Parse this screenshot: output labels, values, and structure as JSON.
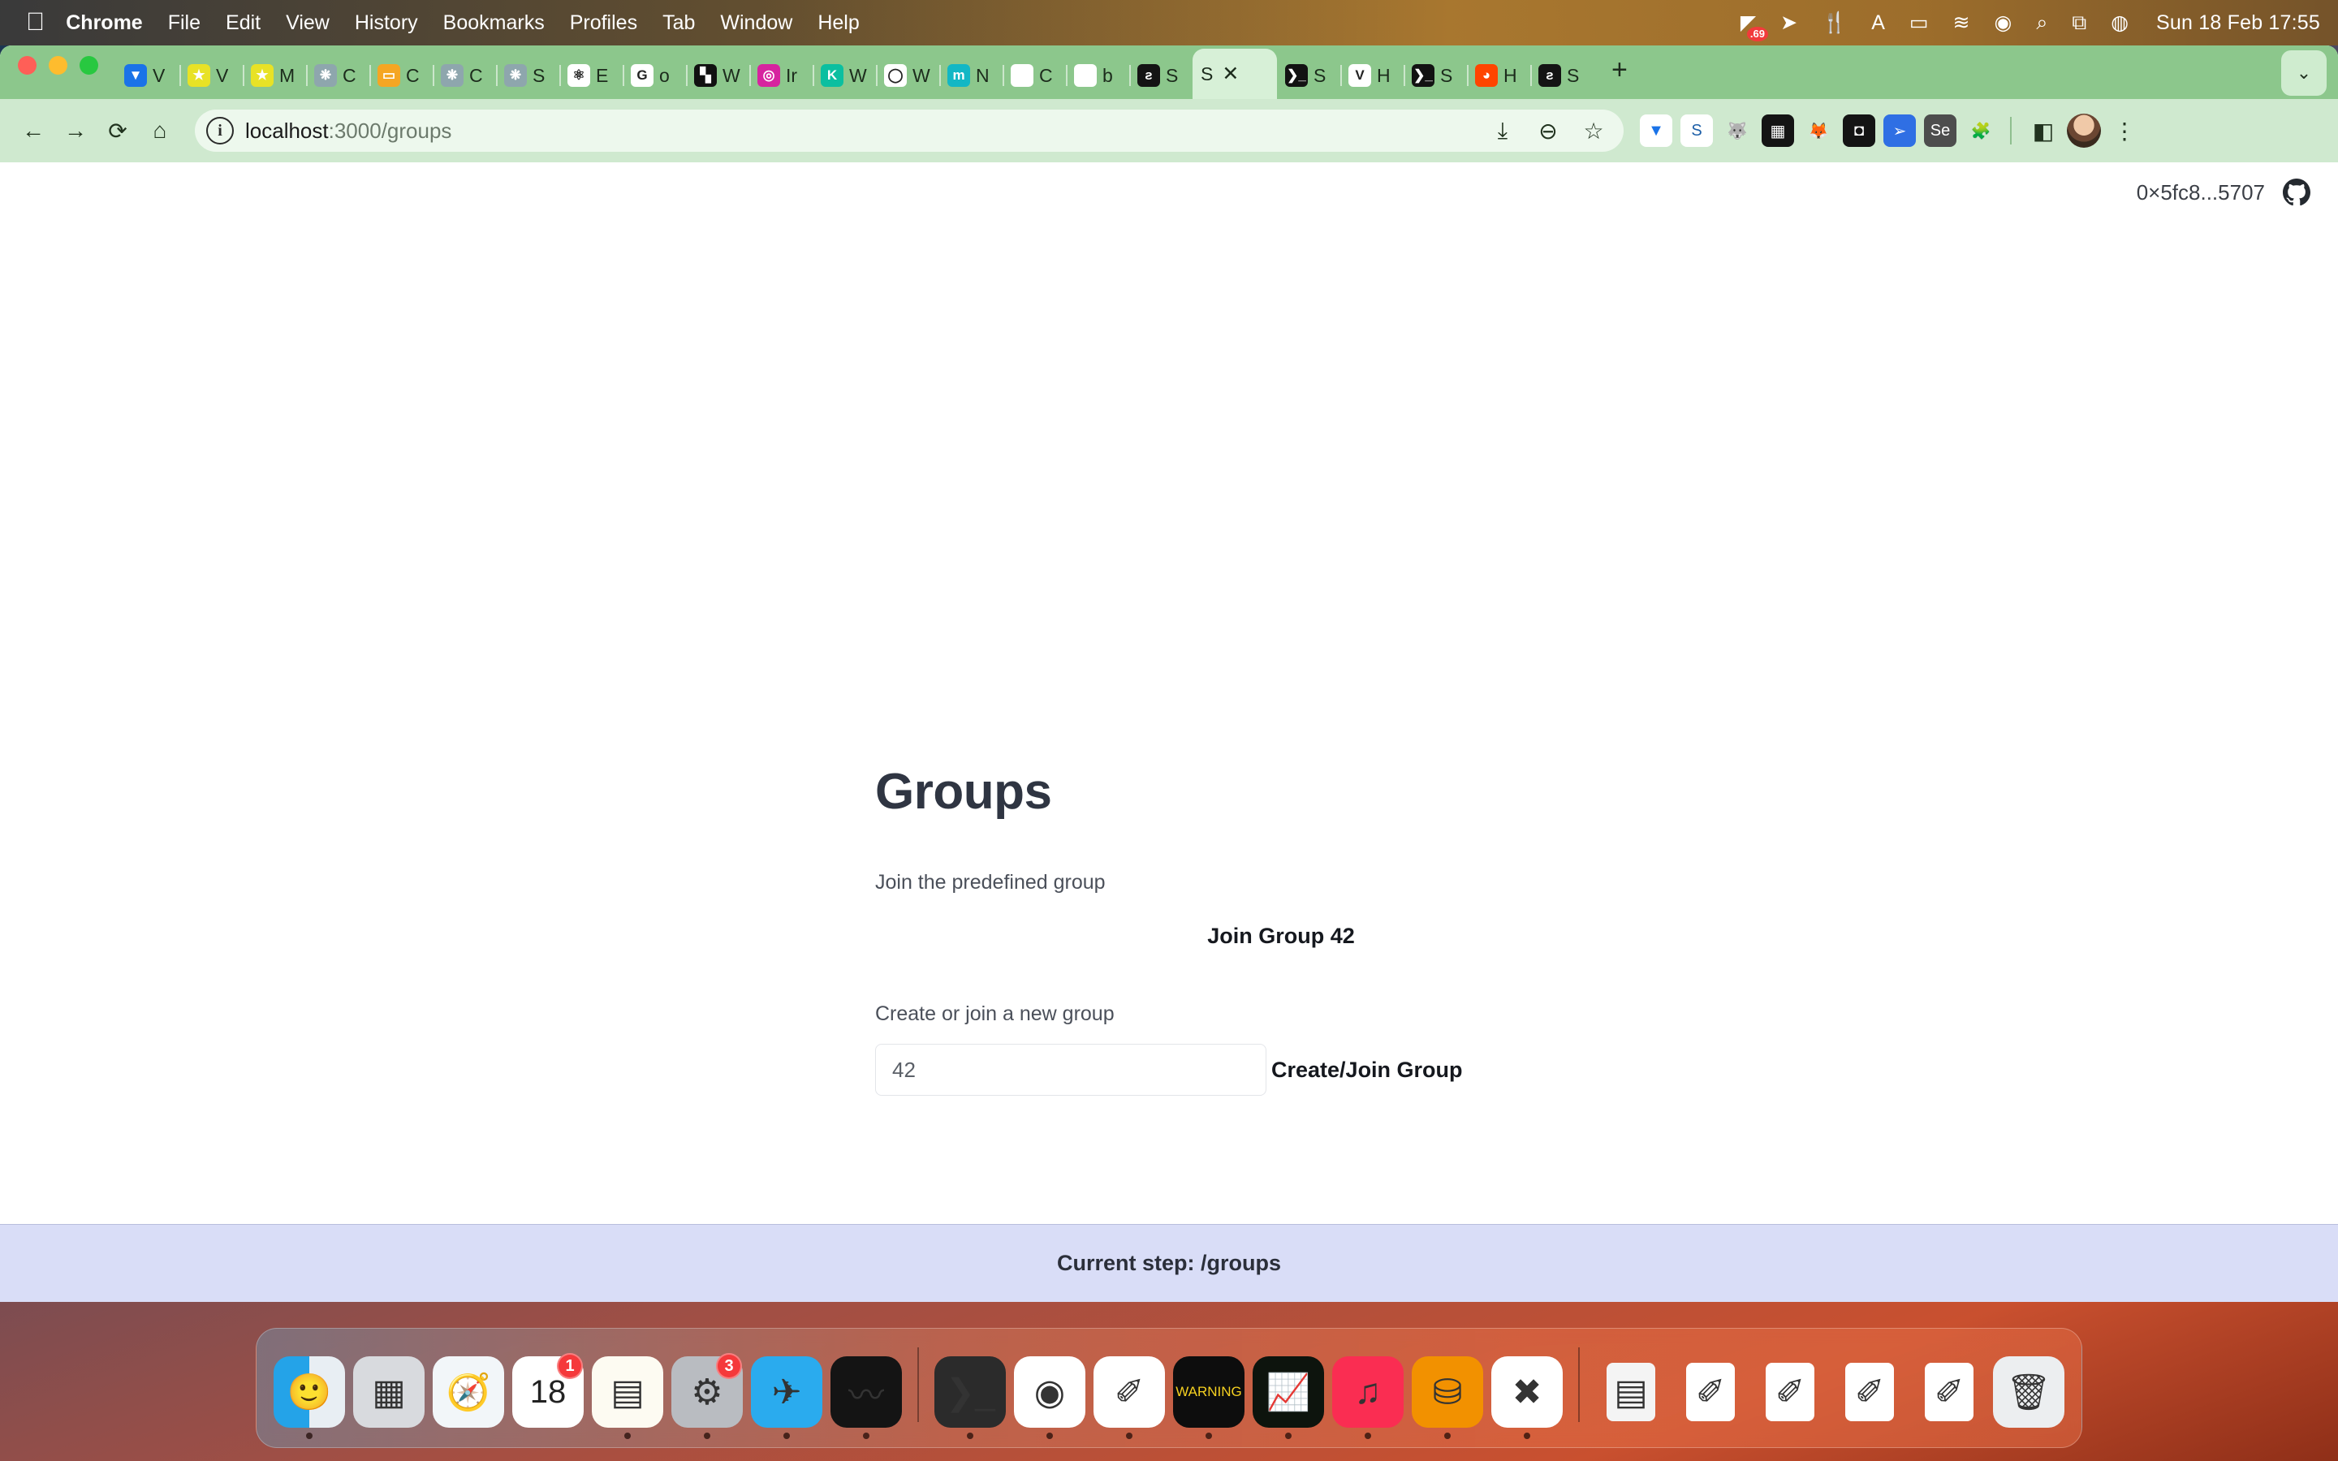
{
  "menubar": {
    "apple_icon": "apple-icon",
    "items": [
      {
        "label": "Chrome",
        "bold": true
      },
      {
        "label": "File",
        "bold": false
      },
      {
        "label": "Edit",
        "bold": false
      },
      {
        "label": "View",
        "bold": false
      },
      {
        "label": "History",
        "bold": false
      },
      {
        "label": "Bookmarks",
        "bold": false
      },
      {
        "label": "Profiles",
        "bold": false
      },
      {
        "label": "Tab",
        "bold": false
      },
      {
        "label": "Window",
        "bold": false
      },
      {
        "label": "Help",
        "bold": false
      }
    ],
    "status_icons": [
      {
        "name": "stats-icon",
        "glyph": "◤",
        "badge": ".69"
      },
      {
        "name": "location-off-icon",
        "glyph": "➤",
        "badge": ""
      },
      {
        "name": "utensils-icon",
        "glyph": "🍴",
        "badge": ""
      },
      {
        "name": "input-source-icon",
        "glyph": "A",
        "badge": ""
      },
      {
        "name": "battery-icon",
        "glyph": "▭",
        "badge": ""
      },
      {
        "name": "wifi-icon",
        "glyph": "≋",
        "badge": ""
      },
      {
        "name": "user-account-icon",
        "glyph": "◉",
        "badge": ""
      },
      {
        "name": "search-icon",
        "glyph": "⌕",
        "badge": ""
      },
      {
        "name": "control-center-icon",
        "glyph": "⧉",
        "badge": ""
      },
      {
        "name": "siri-icon",
        "glyph": "◍",
        "badge": ""
      }
    ],
    "clock": "Sun 18 Feb  17:55"
  },
  "browser": {
    "tabs": [
      {
        "label": "V",
        "favicon": "vite-icon",
        "fav_bg": "#1a73e8",
        "fav_text": "▼",
        "active": false
      },
      {
        "label": "V",
        "favicon": "star-yellow-icon",
        "fav_bg": "#e8e226",
        "fav_text": "★",
        "active": false
      },
      {
        "label": "M",
        "favicon": "star-yellow-icon",
        "fav_bg": "#e8e226",
        "fav_text": "★",
        "active": false
      },
      {
        "label": "C",
        "favicon": "openai-icon",
        "fav_bg": "#8ea6ad",
        "fav_text": "❋",
        "active": false
      },
      {
        "label": "C",
        "favicon": "orange-window-icon",
        "fav_bg": "#f5a623",
        "fav_text": "▭",
        "active": false
      },
      {
        "label": "C",
        "favicon": "openai-icon",
        "fav_bg": "#8ea6ad",
        "fav_text": "❋",
        "active": false
      },
      {
        "label": "S",
        "favicon": "openai-icon",
        "fav_bg": "#8ea6ad",
        "fav_text": "❋",
        "active": false
      },
      {
        "label": "E",
        "favicon": "atom-icon",
        "fav_bg": "#ffffff",
        "fav_text": "⚛",
        "active": false
      },
      {
        "label": "o",
        "favicon": "google-icon",
        "fav_bg": "#ffffff",
        "fav_text": "G",
        "active": false
      },
      {
        "label": "W",
        "favicon": "qr-black-icon",
        "fav_bg": "#111111",
        "fav_text": "▚",
        "active": false
      },
      {
        "label": "Ir",
        "favicon": "instagram-icon",
        "fav_bg": "#d6249f",
        "fav_text": "◎",
        "active": false
      },
      {
        "label": "W",
        "favicon": "kaggle-icon",
        "fav_bg": "#0bbfa0",
        "fav_text": "K",
        "active": false
      },
      {
        "label": "W",
        "favicon": "ellipse-black-icon",
        "fav_bg": "#ffffff",
        "fav_text": "◯",
        "active": false
      },
      {
        "label": "N",
        "favicon": "medium-icon",
        "fav_bg": "#12b7c5",
        "fav_text": "m",
        "active": false
      },
      {
        "label": "C",
        "favicon": "github-icon",
        "fav_bg": "#ffffff",
        "fav_text": "",
        "active": false
      },
      {
        "label": "b",
        "favicon": "github-icon",
        "fav_bg": "#ffffff",
        "fav_text": "",
        "active": false
      },
      {
        "label": "S",
        "favicon": "scroll-black-icon",
        "fav_bg": "#141414",
        "fav_text": "ƨ",
        "active": false
      },
      {
        "label": "S",
        "favicon": "page-icon",
        "fav_bg": "#d7f0d7",
        "fav_text": "",
        "active": true
      },
      {
        "label": "S",
        "favicon": "terminal-icon",
        "fav_bg": "#121212",
        "fav_text": "❯_",
        "active": false
      },
      {
        "label": "H",
        "favicon": "vue-icon",
        "fav_bg": "#ffffff",
        "fav_text": "V",
        "active": false
      },
      {
        "label": "S",
        "favicon": "terminal-icon",
        "fav_bg": "#121212",
        "fav_text": "❯_",
        "active": false
      },
      {
        "label": "H",
        "favicon": "reddit-icon",
        "fav_bg": "#ff4500",
        "fav_text": "◕",
        "active": false
      },
      {
        "label": "S",
        "favicon": "scroll-black-icon",
        "fav_bg": "#141414",
        "fav_text": "ƨ",
        "active": false
      }
    ],
    "close_tab_glyph": "✕",
    "new_tab_glyph": "+",
    "tab_list_glyph": "⌄",
    "nav": {
      "back": "←",
      "forward": "→",
      "reload": "⟳",
      "home": "⌂"
    },
    "omnibox": {
      "info_glyph": "i",
      "url_host": "localhost",
      "url_rest": ":3000/groups",
      "actions": [
        {
          "name": "install-app-icon",
          "glyph": "⤓"
        },
        {
          "name": "zoom-out-icon",
          "glyph": "⊖"
        },
        {
          "name": "bookmark-star-icon",
          "glyph": "☆"
        }
      ]
    },
    "extensions": [
      {
        "name": "vite-extension-icon",
        "glyph": "▼",
        "bg": "#ffffff",
        "color": "#1a73e8"
      },
      {
        "name": "scribe-extension-icon",
        "glyph": "S",
        "bg": "#ffffff",
        "color": "#1d5fa8"
      },
      {
        "name": "wolf-extension-icon",
        "glyph": "🐺",
        "bg": "#cfe9cf",
        "color": "#8a8a8a"
      },
      {
        "name": "dark-grid-extension-icon",
        "glyph": "▦",
        "bg": "#141414",
        "color": "#ffffff"
      },
      {
        "name": "metamask-extension-icon",
        "glyph": "🦊",
        "bg": "#cfe9cf",
        "color": "#e2761b"
      },
      {
        "name": "keyhole-extension-icon",
        "glyph": "◘",
        "bg": "#141414",
        "color": "#ffffff"
      },
      {
        "name": "blue-arrow-extension-icon",
        "glyph": "➢",
        "bg": "#2f6fe4",
        "color": "#ffffff"
      },
      {
        "name": "selenium-extension-icon",
        "glyph": "Se",
        "bg": "#4d4d4d",
        "color": "#ffffff"
      },
      {
        "name": "puzzle-extensions-icon",
        "glyph": "🧩",
        "bg": "#cfe9cf",
        "color": "#2b2b2b"
      }
    ],
    "side_panel_glyph": "◧",
    "menu_glyph": "⋮",
    "profile_name": "avatar"
  },
  "wallet": {
    "address": "0×5fc8...5707",
    "github_icon": "github-icon"
  },
  "main": {
    "title": "Groups",
    "predefined_label": "Join the predefined group",
    "join_button": "Join Group 42",
    "create_label": "Create or join a new group",
    "group_input_value": "42",
    "group_input_placeholder": "42",
    "create_button": "Create/Join Group"
  },
  "footer": {
    "status": "Current step: /groups"
  },
  "dock": {
    "items": [
      {
        "name": "finder",
        "glyph": "🙂",
        "bg": "linear-gradient(90deg,#24a3e8 0 50%,#e8eef3 50% 100%)",
        "badge": "",
        "running": true,
        "small": false
      },
      {
        "name": "launchpad",
        "glyph": "▦",
        "bg": "#d8dade",
        "badge": "",
        "running": false,
        "small": false
      },
      {
        "name": "safari",
        "glyph": "🧭",
        "bg": "#f2f6f9",
        "badge": "",
        "running": false,
        "small": false
      },
      {
        "name": "calendar",
        "glyph": "18",
        "bg": "#ffffff",
        "badge": "1",
        "running": false,
        "small": false
      },
      {
        "name": "notes",
        "glyph": "▤",
        "bg": "#fdfbf2",
        "badge": "",
        "running": true,
        "small": false
      },
      {
        "name": "system-preferences",
        "glyph": "⚙",
        "bg": "#b9bcc1",
        "badge": "3",
        "running": true,
        "small": false
      },
      {
        "name": "telegram",
        "glyph": "✈",
        "bg": "#2aabee",
        "badge": "",
        "running": true,
        "small": false
      },
      {
        "name": "voice-memos",
        "glyph": "〰",
        "bg": "#141414",
        "badge": "",
        "running": true,
        "small": false
      },
      {
        "name": "separator",
        "glyph": "",
        "bg": "",
        "badge": "",
        "running": false,
        "small": false
      },
      {
        "name": "terminal",
        "glyph": "❯_",
        "bg": "#2b2b2b",
        "badge": "",
        "running": true,
        "small": false
      },
      {
        "name": "google-chrome",
        "glyph": "◉",
        "bg": "#ffffff",
        "badge": "",
        "running": true,
        "small": false
      },
      {
        "name": "textedit",
        "glyph": "✐",
        "bg": "#ffffff",
        "badge": "",
        "running": true,
        "small": false
      },
      {
        "name": "watch-warning",
        "glyph": "WARNING",
        "bg": "#0d0d0d",
        "badge": "",
        "running": true,
        "small": false
      },
      {
        "name": "activity-monitor",
        "glyph": "📈",
        "bg": "#0d140d",
        "badge": "",
        "running": true,
        "small": false
      },
      {
        "name": "music",
        "glyph": "♫",
        "bg": "#fa2d52",
        "badge": "",
        "running": true,
        "small": false
      },
      {
        "name": "orange-flowchart-app",
        "glyph": "⛁",
        "bg": "#f29100",
        "badge": "",
        "running": true,
        "small": false
      },
      {
        "name": "visual-studio-code",
        "glyph": "✖",
        "bg": "#ffffff",
        "badge": "",
        "running": true,
        "small": false
      },
      {
        "name": "separator",
        "glyph": "",
        "bg": "",
        "badge": "",
        "running": false,
        "small": false
      },
      {
        "name": "document-stack",
        "glyph": "▤",
        "bg": "#f4f4f4",
        "badge": "",
        "running": false,
        "small": true
      },
      {
        "name": "textedit-document",
        "glyph": "✐",
        "bg": "#ffffff",
        "badge": "",
        "running": false,
        "small": true
      },
      {
        "name": "textedit-document",
        "glyph": "✐",
        "bg": "#ffffff",
        "badge": "",
        "running": false,
        "small": true
      },
      {
        "name": "textedit-document",
        "glyph": "✐",
        "bg": "#ffffff",
        "badge": "",
        "running": false,
        "small": true
      },
      {
        "name": "textedit-document",
        "glyph": "✐",
        "bg": "#ffffff",
        "badge": "",
        "running": false,
        "small": true
      },
      {
        "name": "trash",
        "glyph": "🗑",
        "bg": "#eceef0",
        "badge": "",
        "running": false,
        "small": false
      }
    ]
  }
}
